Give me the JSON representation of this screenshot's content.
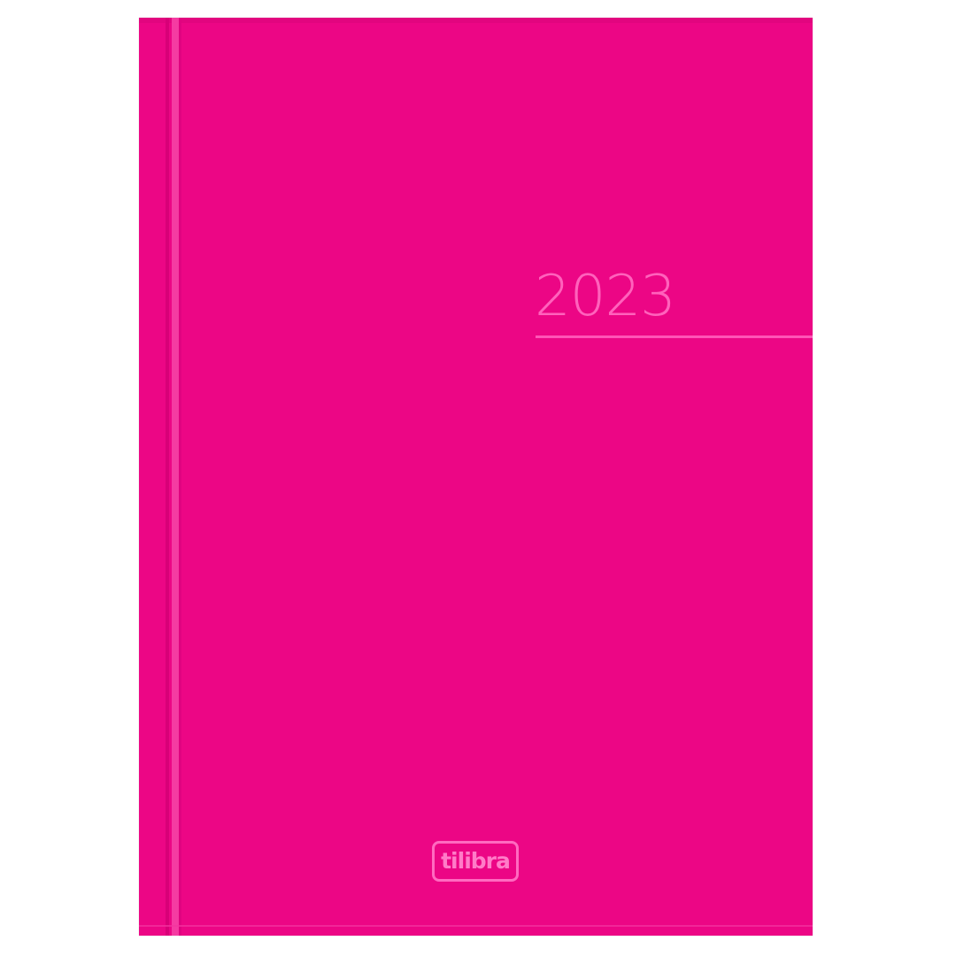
{
  "cover": {
    "year": "2023",
    "brand": "tilibra",
    "color": "#ec0685",
    "accent": "#ff62bc"
  }
}
